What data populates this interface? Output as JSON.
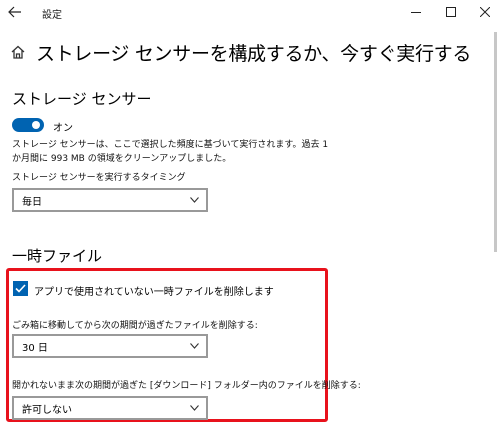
{
  "window": {
    "title": "設定",
    "icons": {
      "back": "back-arrow-icon",
      "minimize": "minimize-icon",
      "maximize": "maximize-icon",
      "close": "close-icon"
    }
  },
  "page": {
    "title": "ストレージ センサーを構成するか、今すぐ実行する",
    "icon": "home-icon"
  },
  "storage_sense": {
    "heading": "ストレージ センサー",
    "toggle_state": "on",
    "toggle_label": "オン",
    "description": "ストレージ センサーは、ここで選択した頻度に基づいて実行されます。過去 1 か月間に 993 MB の領域をクリーンアップしました。",
    "schedule_label": "ストレージ センサーを実行するタイミング",
    "schedule_value": "毎日"
  },
  "temp_files": {
    "heading": "一時ファイル",
    "checkbox_checked": true,
    "checkbox_label": "アプリで使用されていない一時ファイルを削除します",
    "recycle_label": "ごみ箱に移動してから次の期間が過ぎたファイルを削除する:",
    "recycle_value": "30 日",
    "downloads_label": "開かれないまま次の期間が過ぎた [ダウンロード] フォルダー内のファイルを削除する:",
    "downloads_value": "許可しない"
  },
  "colors": {
    "accent": "#0063b1",
    "highlight": "#e8121c"
  }
}
